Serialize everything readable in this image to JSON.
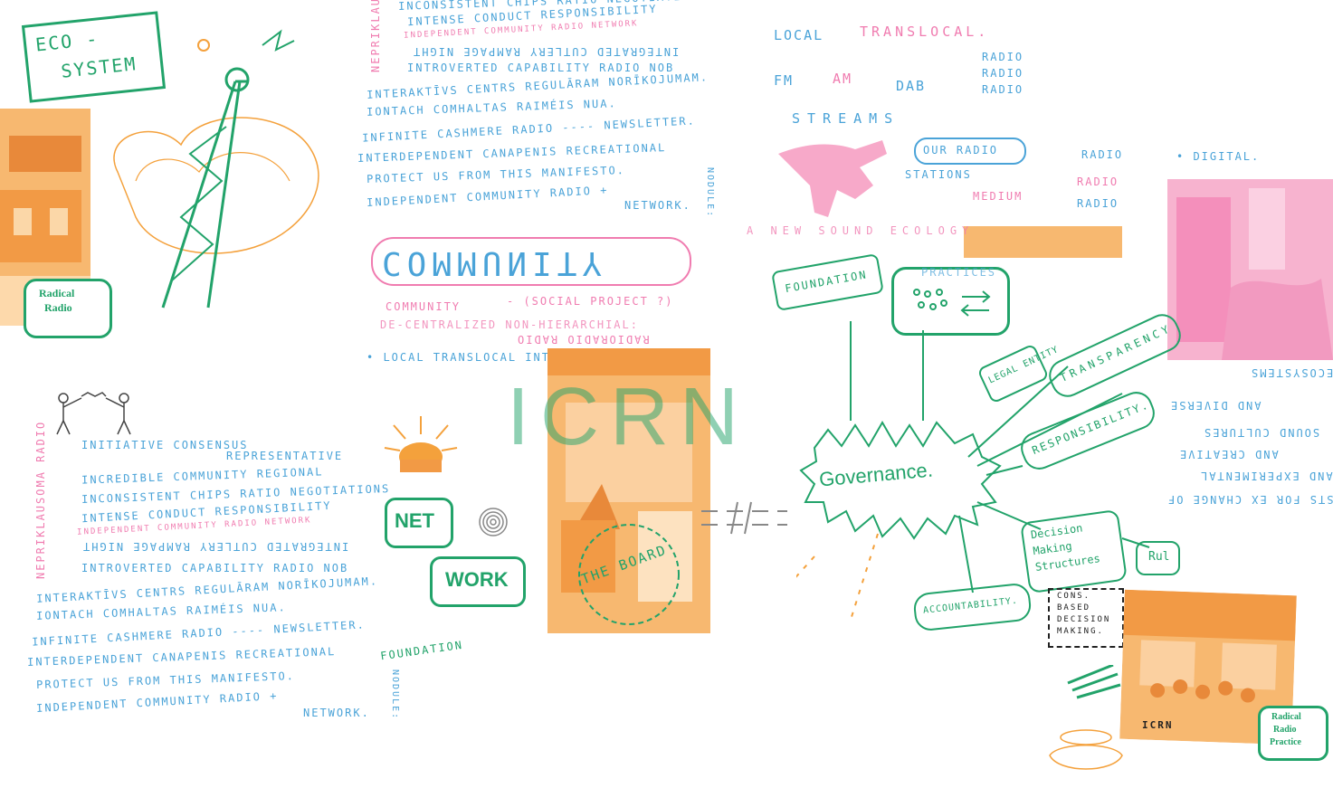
{
  "colors": {
    "green": "#22a36a",
    "blue": "#4aa3d8",
    "pink": "#f07cb0",
    "orange": "#f4a13c"
  },
  "eco_system": {
    "line1": "ECO -",
    "line2": "SYSTEM"
  },
  "radical_radio_practice": {
    "line1": "Radical",
    "line2": "Radio",
    "line3": "Practice"
  },
  "upper_manifesto": [
    "INCONSISTENT CHIPS RATIO NEGOTIATIONS",
    "INTENSE CONDUCT RESPONSIBILITY",
    "INDEPENDENT COMMUNITY RADIO NETWORK",
    "INTEGRATED CUTLERY RAMPAGE NIGHT",
    "INTROVERTED CAPABILITY RADIO NOB",
    "INTERAKTĪVS CENTRS REGULĀRAM NORĪKOJUMAM.",
    "IONTACH COMHALTAS RAIMÉIS NUA.",
    "INFINITE CASHMERE RADIO ---- NEWSLETTER.",
    "INTERDEPENDENT CANAPENIS RECREATIONAL",
    "PROTECT US FROM THIS MANIFESTO.",
    "INDEPENDENT COMMUNITY RADIO +",
    "NETWORK."
  ],
  "lower_manifesto": [
    "INITIATIVE CONSENSUS",
    "REPRESENTATIVE",
    "INCREDIBLE COMMUNITY REGIONAL",
    "INCONSISTENT CHIPS RATIO NEGOTIATIONS",
    "INTENSE CONDUCT RESPONSIBILITY",
    "INDEPENDENT COMMUNITY RADIO NETWORK",
    "INTEGRATED CUTLERY RAMPAGE NIGHT",
    "INTROVERTED CAPABILITY RADIO NOB",
    "INTERAKTĪVS CENTRS REGULĀRAM NORĪKOJUMAM.",
    "IONTACH COMHALTAS RAIMÉIS NUA.",
    "INFINITE CASHMERE RADIO ---- NEWSLETTER.",
    "INTERDEPENDENT CANAPENIS RECREATIONAL",
    "PROTECT US FROM THIS MANIFESTO.",
    "INDEPENDENT COMMUNITY RADIO +",
    "NETWORK."
  ],
  "side_labels": {
    "nepriklauso": "NEPRIKLAUSOMA RADIO",
    "nodule": "NODULE:"
  },
  "community": {
    "big": "COMMUNITY",
    "word": "COMMUNITY",
    "social": "- (SOCIAL PROJECT ?)",
    "decentral": "DE-CENTRALIZED NON-HIERARCHIAL:",
    "radioradio": "RADIORADIO RADIO",
    "scale": "• LOCAL   TRANSLOCAL   INTERNATIONAL"
  },
  "icrn": "ICRN",
  "net": "NET",
  "work": "WORK",
  "board": "THE BOARD",
  "local": "LOCAL",
  "translocal": "TRANSLOCAL.",
  "fm": "FM",
  "am": "AM",
  "dab": "DAB",
  "radio_stack": [
    "RADIO",
    "RADIO",
    "RADIO"
  ],
  "streams": "STREAMS",
  "our_radio": "OUR RADIO",
  "stations": "STATIONS",
  "medium": "MEDIUM",
  "digital": "• DIGITAL.",
  "radio_right": [
    "RADIO",
    "RADIO",
    "RADIO"
  ],
  "sound_ecology": "A NEW SOUND ECOLOGY",
  "sonic_practices": "PRACTICES",
  "foundation": "FOUNDATION",
  "governance": "Governance.",
  "legal_entity": "LEGAL ENTITY",
  "transparency": "TRANSPARENCY",
  "responsibility": "RESPONSIBILITY.",
  "accountability": "ACCOUNTABILITY.",
  "decision": {
    "l1": "Decision",
    "l2": "Making",
    "l3": "Structures"
  },
  "rules": "Rul",
  "consensus": {
    "l1": "CONS.",
    "l2": "BASED",
    "l3": "DECISION",
    "l4": "MAKING."
  },
  "mirrored_right": [
    "ECOSYSTEMS",
    "AND DIVERSE",
    "SOUND CULTURES",
    "AND CREATIVE",
    "AND EXPERIMENTAL",
    "STS FOR EX CHANGE OF"
  ],
  "icrn_small": "ICRN",
  "foundation_lower": "FOUNDATION"
}
